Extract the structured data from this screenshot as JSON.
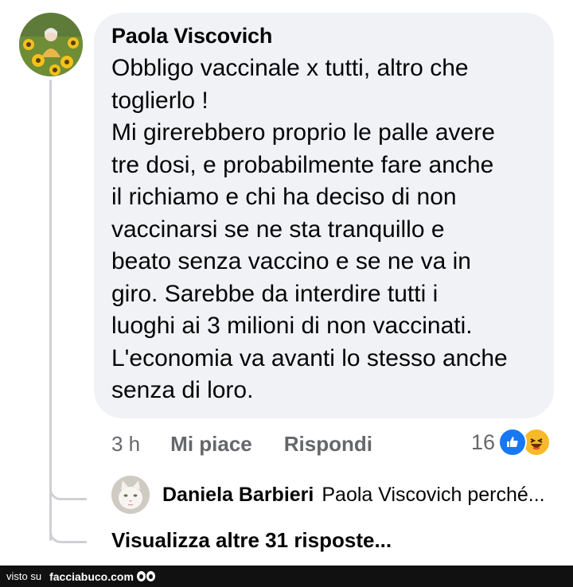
{
  "comment": {
    "author": "Paola Viscovich",
    "lines": [
      "Obbligo vaccinale x tutti,  altro che",
      "toglierlo !",
      "Mi girerebbero proprio le palle avere",
      "tre dosi, e probabilmente fare anche",
      "il  richiamo e chi ha deciso di non",
      "vaccinarsi se ne sta tranquillo e",
      "beato senza vaccino e se ne va in",
      "giro. Sarebbe da interdire tutti i",
      "luoghi ai 3 milioni di non vaccinati.",
      "L'economia va avanti lo stesso anche",
      "senza di loro."
    ],
    "time": "3 h",
    "like_label": "Mi piace",
    "reply_label": "Rispondi",
    "reaction_count": "16",
    "reaction_icons": [
      "like-icon",
      "haha-icon"
    ],
    "reaction_colors": {
      "like": "#1877f2",
      "haha": "#f7b928"
    }
  },
  "reply": {
    "author": "Daniela Barbieri",
    "text": "Paola Viscovich perché..."
  },
  "more_replies": "Visualizza altre 31 risposte...",
  "footer": {
    "visto": "visto su",
    "site": "facciabuco.com"
  }
}
